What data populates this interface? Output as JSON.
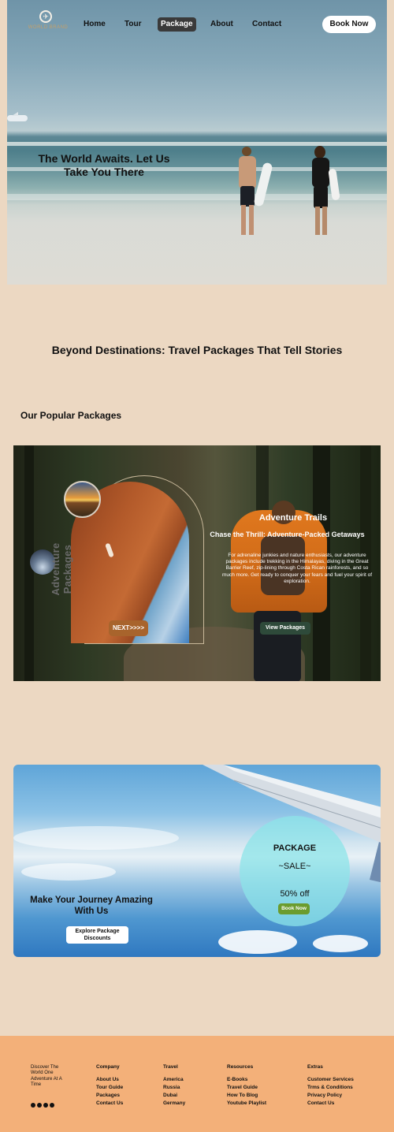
{
  "brand": {
    "logo_text": "WORLD BRAND"
  },
  "nav": {
    "items": [
      {
        "label": "Home"
      },
      {
        "label": "Tour"
      },
      {
        "label": "Package"
      },
      {
        "label": "About"
      },
      {
        "label": "Contact"
      }
    ],
    "active": "Package",
    "book_label": "Book Now"
  },
  "hero": {
    "title": "The World Awaits. Let Us Take You There"
  },
  "section": {
    "title": "Beyond Destinations: Travel Packages That Tell Stories",
    "popular": "Our Popular Packages"
  },
  "adventure": {
    "vertical_label": "Adventure Packages",
    "next_label": "NEXT>>>>",
    "title": "Adventure Trails",
    "subtitle": "Chase the Thrill: Adventure-Packed Getaways",
    "description": "For adrenaline junkies and nature enthusiasts, our adventure packages include trekking in the Himalayas, diving in the Great Barrier Reef, zip-lining through Costa Rican rainforests, and so much more. Get ready to conquer your fears and fuel your spirit of exploration.",
    "view_label": "View Packages"
  },
  "sale": {
    "package_label": "PACKAGE",
    "sale_label": "~SALE~",
    "discount": "50% off",
    "book_label": "Book Now",
    "headline": "Make Your Journey Amazing With Us",
    "explore_label": "Explore Package Discounts"
  },
  "footer": {
    "tagline": "Discover The World One Adventure At A Time",
    "social": [
      "facebook-icon",
      "x-icon",
      "instagram-icon",
      "linkedin-icon"
    ],
    "columns": [
      {
        "heading": "Company",
        "links": [
          "About Us",
          "Tour Guide",
          "Packages",
          "Contact Us"
        ]
      },
      {
        "heading": "Travel",
        "links": [
          "America",
          "Russia",
          "Dubai",
          "Germany"
        ]
      },
      {
        "heading": "Resources",
        "links": [
          "E-Books",
          "Travel Guide",
          "How To Blog",
          "Youtube Playlist"
        ]
      },
      {
        "heading": "Extras",
        "links": [
          "Customer Services",
          "Trms & Conditions",
          "Privacy Policy",
          "Contact Us"
        ]
      }
    ]
  }
}
